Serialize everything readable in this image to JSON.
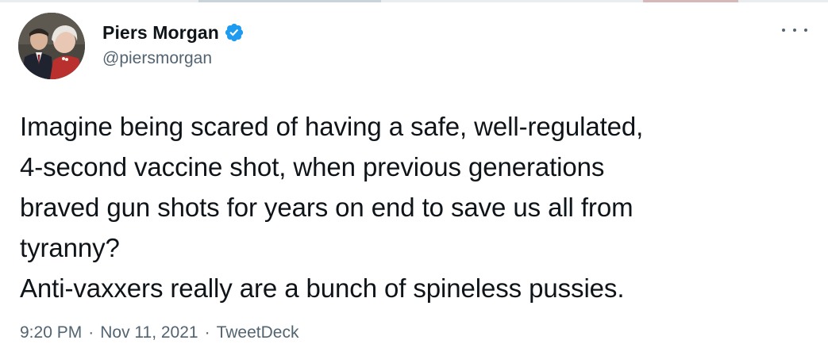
{
  "author": {
    "display_name": "Piers Morgan",
    "handle": "@piersmorgan",
    "verified": true
  },
  "tweet": {
    "lines": [
      "Imagine being scared of having a safe, well-regulated,",
      "4-second vaccine shot, when previous generations",
      "braved gun shots for years on end to save us all from",
      "tyranny?",
      "Anti-vaxxers really are a bunch of spineless pussies."
    ]
  },
  "meta": {
    "time": "9:20 PM",
    "separator": "·",
    "date": "Nov 11, 2021",
    "source": "TweetDeck"
  },
  "icons": {
    "verified": "verified-badge-icon",
    "more": "more-options-icon"
  },
  "colors": {
    "verified_blue": "#1d9bf0",
    "text_primary": "#0f1419",
    "text_secondary": "#536471"
  }
}
